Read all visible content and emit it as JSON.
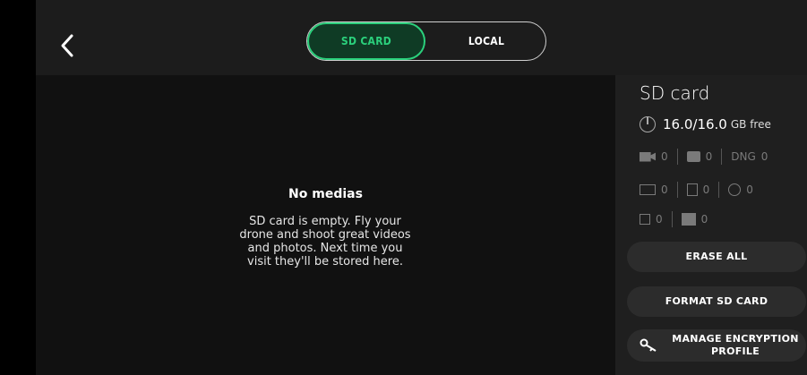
{
  "header": {
    "back_icon": "chevron-left-icon",
    "tabs": [
      {
        "label": "SD CARD",
        "active": true
      },
      {
        "label": "LOCAL",
        "active": false
      }
    ]
  },
  "main": {
    "empty_title": "No medias",
    "empty_message": "SD card is empty. Fly your drone and shoot great videos and photos. Next time you visit they'll be stored here."
  },
  "sidebar": {
    "title": "SD card",
    "storage": {
      "value": "16.0/16.0",
      "unit": "GB free",
      "icon": "storage-pie-icon"
    },
    "counts": {
      "video": "0",
      "photo": "0",
      "dng_label": "DNG",
      "dng": "0",
      "panorama": "0",
      "timelapse": "0",
      "spherical": "0",
      "single": "0",
      "burst": "0"
    },
    "buttons": {
      "erase_all": "ERASE ALL",
      "format": "FORMAT SD CARD",
      "encryption": "MANAGE ENCRYPTION PROFILE"
    }
  },
  "colors": {
    "accent": "#2bd07c",
    "accent_bg": "#0f3b25",
    "background": "#111111",
    "panel": "#1f1f1f"
  }
}
